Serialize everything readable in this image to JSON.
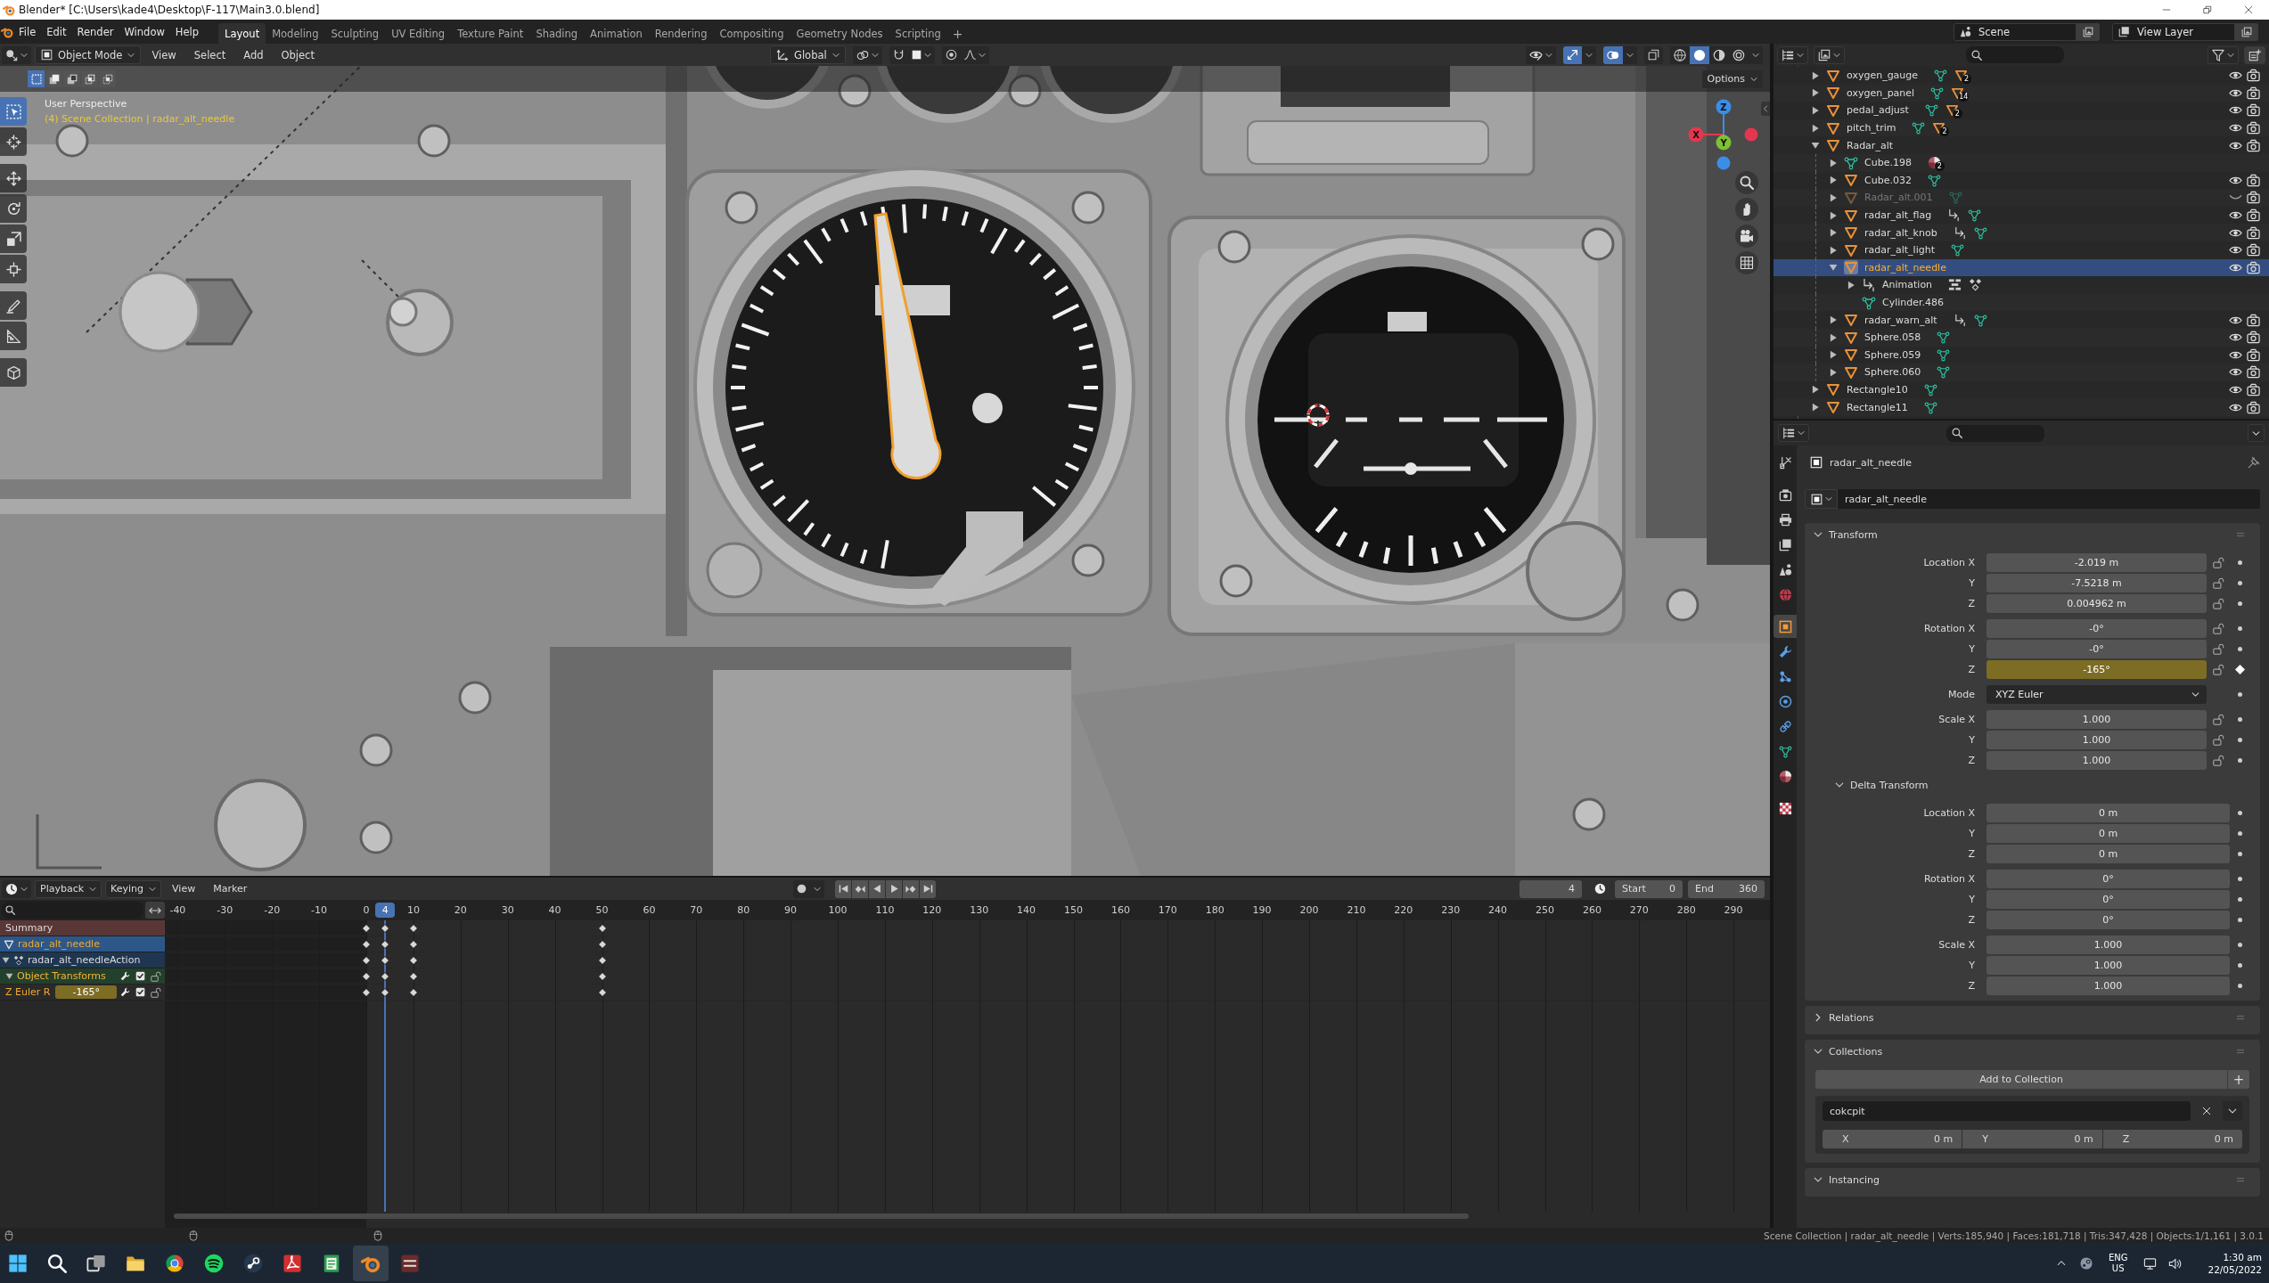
{
  "window": {
    "title": "Blender* [C:\\Users\\kade4\\Desktop\\F-117\\Main3.0.blend]"
  },
  "top_bar": {
    "menus": [
      "File",
      "Edit",
      "Render",
      "Window",
      "Help"
    ],
    "workspaces": [
      {
        "label": "Layout",
        "selected": true
      },
      {
        "label": "Modeling",
        "selected": false
      },
      {
        "label": "Sculpting",
        "selected": false
      },
      {
        "label": "UV Editing",
        "selected": false
      },
      {
        "label": "Texture Paint",
        "selected": false
      },
      {
        "label": "Shading",
        "selected": false
      },
      {
        "label": "Animation",
        "selected": false
      },
      {
        "label": "Rendering",
        "selected": false
      },
      {
        "label": "Compositing",
        "selected": false
      },
      {
        "label": "Geometry Nodes",
        "selected": false
      },
      {
        "label": "Scripting",
        "selected": false
      }
    ],
    "add_workspace": "+",
    "scene": "Scene",
    "view_layer": "View Layer"
  },
  "viewport": {
    "mode": "Object Mode",
    "menus": [
      "View",
      "Select",
      "Add",
      "Object"
    ],
    "orientation": "Global",
    "gizmos_on": true,
    "overlays_on": true,
    "xray_on": false,
    "shading": [
      {
        "kind": "wireframe",
        "selected": false
      },
      {
        "kind": "solid",
        "selected": true
      },
      {
        "kind": "material",
        "selected": false
      },
      {
        "kind": "rendered",
        "selected": false
      }
    ],
    "select_modes": [
      {
        "kind": "set",
        "selected": true
      },
      {
        "kind": "extend",
        "selected": false
      },
      {
        "kind": "subtract",
        "selected": false
      },
      {
        "kind": "invert",
        "selected": false
      },
      {
        "kind": "intersect",
        "selected": false
      }
    ],
    "tools": [
      {
        "kind": "select",
        "selected": true
      },
      {
        "kind": "cursor",
        "selected": false
      },
      {
        "kind": "move",
        "selected": false
      },
      {
        "kind": "rotate",
        "selected": false
      },
      {
        "kind": "scale",
        "selected": false
      },
      {
        "kind": "transform",
        "selected": false
      },
      {
        "kind": "annotate",
        "selected": false
      },
      {
        "kind": "measure",
        "selected": false
      },
      {
        "kind": "add_cube",
        "selected": false
      }
    ],
    "view_name": "User Perspective",
    "collection_info": "(4) Scene Collection | radar_alt_needle",
    "options": "Options",
    "axes": [
      {
        "label": "Z",
        "color": "#3a8ee6"
      },
      {
        "label": "X",
        "color": "#e4374f"
      },
      {
        "label": "Y",
        "color": "#7fc034"
      }
    ]
  },
  "outliner": {
    "rows": [
      {
        "name": "oxygen_gauge",
        "kind": "object",
        "expandable": true,
        "expanded": false,
        "selected": false,
        "disabled": false,
        "visible": true,
        "badges": [
          {
            "kind": "mesh"
          },
          {
            "kind": "object",
            "count": "2"
          }
        ]
      },
      {
        "name": "oxygen_panel",
        "kind": "object",
        "expandable": true,
        "expanded": false,
        "selected": false,
        "disabled": false,
        "visible": true,
        "badges": [
          {
            "kind": "mesh"
          },
          {
            "kind": "object",
            "count": "14"
          }
        ]
      },
      {
        "name": "pedal_adjust",
        "kind": "object",
        "expandable": true,
        "expanded": false,
        "selected": false,
        "disabled": false,
        "visible": true,
        "badges": [
          {
            "kind": "mesh"
          },
          {
            "kind": "object",
            "count": "2"
          }
        ]
      },
      {
        "name": "pitch_trim",
        "kind": "object",
        "expandable": true,
        "expanded": false,
        "selected": false,
        "disabled": false,
        "visible": true,
        "badges": [
          {
            "kind": "mesh"
          },
          {
            "kind": "object",
            "count": "2"
          }
        ]
      },
      {
        "name": "Radar_alt",
        "kind": "object",
        "expandable": true,
        "expanded": true,
        "selected": false,
        "disabled": false,
        "visible": true,
        "children": [
          {
            "name": "Cube.198",
            "kind": "mesh",
            "expandable": true,
            "expanded": false,
            "selected": false,
            "disabled": false,
            "badges": [
              {
                "kind": "material",
                "count": "2"
              }
            ]
          },
          {
            "name": "Cube.032",
            "kind": "object",
            "expandable": true,
            "expanded": false,
            "selected": false,
            "disabled": false,
            "visible": true,
            "badges": [
              {
                "kind": "mesh"
              }
            ]
          },
          {
            "name": "Radar_alt.001",
            "kind": "object",
            "expandable": true,
            "expanded": false,
            "selected": false,
            "disabled": true,
            "visible": false,
            "badges": [
              {
                "kind": "mesh"
              }
            ]
          },
          {
            "name": "radar_alt_flag",
            "kind": "object",
            "expandable": true,
            "expanded": false,
            "selected": false,
            "disabled": false,
            "visible": true,
            "badges": [
              {
                "kind": "animation"
              },
              {
                "kind": "mesh"
              }
            ]
          },
          {
            "name": "radar_alt_knob",
            "kind": "object",
            "expandable": true,
            "expanded": false,
            "selected": false,
            "disabled": false,
            "visible": true,
            "badges": [
              {
                "kind": "animation"
              },
              {
                "kind": "mesh"
              }
            ]
          },
          {
            "name": "radar_alt_light",
            "kind": "object",
            "expandable": true,
            "expanded": false,
            "selected": false,
            "disabled": false,
            "visible": true,
            "badges": [
              {
                "kind": "mesh"
              }
            ]
          },
          {
            "name": "radar_alt_needle",
            "kind": "object",
            "expandable": true,
            "expanded": true,
            "selected": true,
            "disabled": false,
            "visible": true,
            "children": [
              {
                "name": "Animation",
                "kind": "animation",
                "expandable": true,
                "expanded": false,
                "selected": false,
                "disabled": false,
                "badges": [
                  {
                    "kind": "nla"
                  },
                  {
                    "kind": "action"
                  }
                ]
              },
              {
                "name": "Cylinder.486",
                "kind": "mesh",
                "expandable": false,
                "selected": false,
                "disabled": false
              }
            ]
          },
          {
            "name": "radar_warn_alt",
            "kind": "object",
            "expandable": true,
            "expanded": false,
            "selected": false,
            "disabled": false,
            "visible": true,
            "badges": [
              {
                "kind": "animation"
              },
              {
                "kind": "mesh"
              }
            ]
          },
          {
            "name": "Sphere.058",
            "kind": "object",
            "expandable": true,
            "expanded": false,
            "selected": false,
            "disabled": false,
            "visible": true,
            "badges": [
              {
                "kind": "mesh"
              }
            ]
          },
          {
            "name": "Sphere.059",
            "kind": "object",
            "expandable": true,
            "expanded": false,
            "selected": false,
            "disabled": false,
            "visible": true,
            "badges": [
              {
                "kind": "mesh"
              }
            ]
          },
          {
            "name": "Sphere.060",
            "kind": "object",
            "expandable": true,
            "expanded": false,
            "selected": false,
            "disabled": false,
            "visible": true,
            "badges": [
              {
                "kind": "mesh"
              }
            ]
          }
        ]
      },
      {
        "name": "Rectangle10",
        "kind": "object",
        "expandable": true,
        "expanded": false,
        "selected": false,
        "disabled": false,
        "visible": true,
        "badges": [
          {
            "kind": "mesh"
          }
        ]
      },
      {
        "name": "Rectangle11",
        "kind": "object",
        "expandable": true,
        "expanded": false,
        "selected": false,
        "disabled": false,
        "visible": true,
        "badges": [
          {
            "kind": "mesh"
          }
        ]
      }
    ]
  },
  "properties": {
    "tabs": [
      {
        "kind": "tool",
        "selected": false
      },
      {
        "kind": "render",
        "selected": false
      },
      {
        "kind": "output",
        "selected": false
      },
      {
        "kind": "view_layer",
        "selected": false
      },
      {
        "kind": "scene",
        "selected": false
      },
      {
        "kind": "world",
        "selected": false
      },
      {
        "kind": "object",
        "selected": true
      },
      {
        "kind": "modifiers",
        "selected": false
      },
      {
        "kind": "particles",
        "selected": false
      },
      {
        "kind": "physics",
        "selected": false
      },
      {
        "kind": "constraints",
        "selected": false
      },
      {
        "kind": "data",
        "selected": false
      },
      {
        "kind": "material",
        "selected": false
      },
      {
        "kind": "texture",
        "selected": false
      }
    ],
    "object_name": "radar_alt_needle",
    "datablock": "radar_alt_needle",
    "panels": [
      {
        "kind": "transform",
        "title": "Transform",
        "expanded": true,
        "groups": [
          {
            "rows": [
              {
                "kind": "number",
                "label": "Location X",
                "value": "-2.019 m",
                "lock": true,
                "keyframed": false
              },
              {
                "kind": "number",
                "label": "Y",
                "value": "-7.5218 m",
                "lock": true,
                "keyframed": false
              },
              {
                "kind": "number",
                "label": "Z",
                "value": "0.004962 m",
                "lock": true,
                "keyframed": false
              }
            ]
          },
          {
            "rows": [
              {
                "kind": "number",
                "label": "Rotation X",
                "value": "-0°",
                "lock": true,
                "keyframed": false
              },
              {
                "kind": "number",
                "label": "Y",
                "value": "-0°",
                "lock": true,
                "keyframed": false
              },
              {
                "kind": "number",
                "label": "Z",
                "value": "-165°",
                "lock": true,
                "keyframed": true
              }
            ]
          },
          {
            "rows": [
              {
                "kind": "dropdown",
                "label": "Mode",
                "value": "XYZ Euler",
                "lock": false,
                "keyframed": false
              }
            ]
          },
          {
            "rows": [
              {
                "kind": "number",
                "label": "Scale X",
                "value": "1.000",
                "lock": true,
                "keyframed": false
              },
              {
                "kind": "number",
                "label": "Y",
                "value": "1.000",
                "lock": true,
                "keyframed": false
              },
              {
                "kind": "number",
                "label": "Z",
                "value": "1.000",
                "lock": true,
                "keyframed": false
              }
            ]
          }
        ],
        "subpanel": {
          "title": "Delta Transform",
          "expanded": true,
          "groups": [
            {
              "rows": [
                {
                  "kind": "number",
                  "label": "Location X",
                  "value": "0 m",
                  "lock": false,
                  "keyframed": false
                },
                {
                  "kind": "number",
                  "label": "Y",
                  "value": "0 m",
                  "lock": false,
                  "keyframed": false
                },
                {
                  "kind": "number",
                  "label": "Z",
                  "value": "0 m",
                  "lock": false,
                  "keyframed": false
                }
              ]
            },
            {
              "rows": [
                {
                  "kind": "number",
                  "label": "Rotation X",
                  "value": "0°",
                  "lock": false,
                  "keyframed": false
                },
                {
                  "kind": "number",
                  "label": "Y",
                  "value": "0°",
                  "lock": false,
                  "keyframed": false
                },
                {
                  "kind": "number",
                  "label": "Z",
                  "value": "0°",
                  "lock": false,
                  "keyframed": false
                }
              ]
            },
            {
              "rows": [
                {
                  "kind": "number",
                  "label": "Scale X",
                  "value": "1.000",
                  "lock": false,
                  "keyframed": false
                },
                {
                  "kind": "number",
                  "label": "Y",
                  "value": "1.000",
                  "lock": false,
                  "keyframed": false
                },
                {
                  "kind": "number",
                  "label": "Z",
                  "value": "1.000",
                  "lock": false,
                  "keyframed": false
                }
              ]
            }
          ]
        }
      },
      {
        "kind": "section",
        "title": "Relations",
        "expanded": false
      },
      {
        "kind": "collections",
        "title": "Collections",
        "expanded": true,
        "add_button": "Add to Collection",
        "add_icon": "+",
        "collection": "cokcpit",
        "offsets": [
          {
            "label": "X",
            "value": "0 m"
          },
          {
            "label": "Y",
            "value": "0 m"
          },
          {
            "label": "Z",
            "value": "0 m"
          }
        ]
      },
      {
        "kind": "section",
        "title": "Instancing",
        "expanded": true
      }
    ]
  },
  "timeline": {
    "menus": [
      {
        "label": "Playback",
        "dropdown": true
      },
      {
        "label": "Keying",
        "dropdown": true
      },
      {
        "label": "View",
        "dropdown": false
      },
      {
        "label": "Marker",
        "dropdown": false
      }
    ],
    "auto_key": false,
    "current_frame": "4",
    "start_label": "Start",
    "start": "0",
    "end_label": "End",
    "end": "360",
    "ruler": [
      {
        "label": "-40",
        "keyed": false
      },
      {
        "label": "-30",
        "keyed": false
      },
      {
        "label": "-20",
        "keyed": false
      },
      {
        "label": "-10",
        "keyed": false
      },
      {
        "label": "0",
        "keyed": true
      },
      {
        "label": "10",
        "keyed": true
      },
      {
        "label": "20",
        "keyed": false
      },
      {
        "label": "30",
        "keyed": false
      },
      {
        "label": "40",
        "keyed": false
      },
      {
        "label": "50",
        "keyed": true
      },
      {
        "label": "60",
        "keyed": false
      },
      {
        "label": "70",
        "keyed": false
      },
      {
        "label": "80",
        "keyed": false
      },
      {
        "label": "90",
        "keyed": false
      },
      {
        "label": "100",
        "keyed": false
      },
      {
        "label": "110",
        "keyed": false
      },
      {
        "label": "120",
        "keyed": false
      },
      {
        "label": "130",
        "keyed": false
      },
      {
        "label": "140",
        "keyed": false
      },
      {
        "label": "150",
        "keyed": false
      },
      {
        "label": "160",
        "keyed": false
      },
      {
        "label": "170",
        "keyed": false
      },
      {
        "label": "180",
        "keyed": false
      },
      {
        "label": "190",
        "keyed": false
      },
      {
        "label": "200",
        "keyed": false
      },
      {
        "label": "210",
        "keyed": false
      },
      {
        "label": "220",
        "keyed": false
      },
      {
        "label": "230",
        "keyed": false
      },
      {
        "label": "240",
        "keyed": false
      },
      {
        "label": "250",
        "keyed": false
      },
      {
        "label": "260",
        "keyed": false
      },
      {
        "label": "270",
        "keyed": false
      },
      {
        "label": "280",
        "keyed": false
      },
      {
        "label": "290",
        "keyed": false
      }
    ],
    "ruler_current": "4",
    "current_frame_keyed": true,
    "channels": [
      {
        "kind": "summary",
        "name": "Summary"
      },
      {
        "kind": "object",
        "name": "radar_alt_needle"
      },
      {
        "kind": "action",
        "name": "radar_alt_needleAction",
        "expanded": true
      },
      {
        "kind": "group",
        "name": "Object Transforms",
        "expanded": true,
        "enabled": true
      },
      {
        "kind": "fcurve",
        "name": "Z Euler R",
        "value": "-165°",
        "enabled": true
      }
    ]
  },
  "status_bar": {
    "text": "Scene Collection | radar_alt_needle | Verts:185,940 | Faces:181,718 | Tris:347,428 | Objects:1/1,161 | 3.0.1"
  },
  "taskbar": {
    "apps": [
      {
        "kind": "start",
        "active": false
      },
      {
        "kind": "search",
        "active": false
      },
      {
        "kind": "task_view",
        "active": false
      },
      {
        "kind": "folder",
        "active": false
      },
      {
        "kind": "browser",
        "active": false
      },
      {
        "kind": "music",
        "active": false
      },
      {
        "kind": "game_store",
        "active": false
      },
      {
        "kind": "pdf",
        "active": false
      },
      {
        "kind": "notes",
        "active": false
      },
      {
        "kind": "blender",
        "active": true
      },
      {
        "kind": "game",
        "active": false
      }
    ],
    "language": "ENG",
    "region": "US",
    "time": "1:30 am",
    "date": "22/05/2022"
  }
}
